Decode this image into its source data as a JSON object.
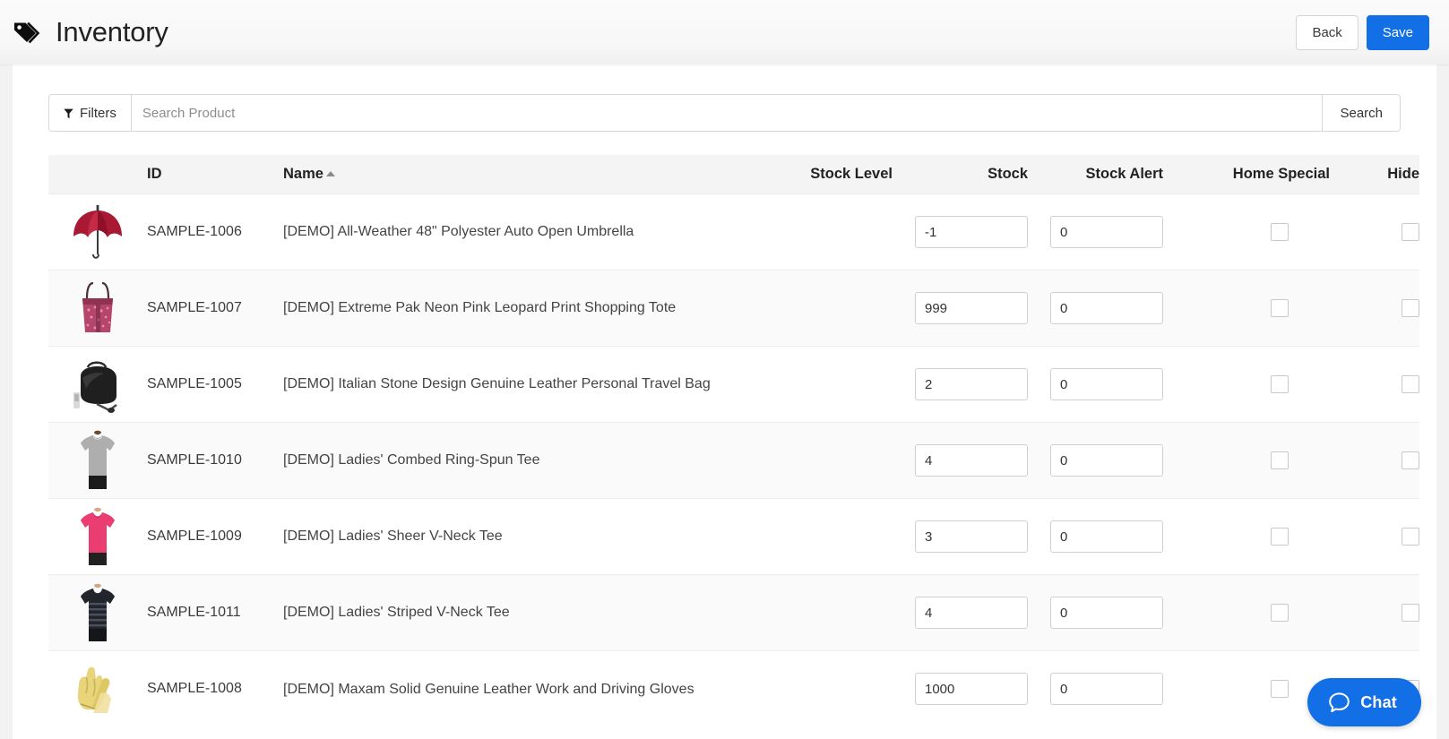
{
  "header": {
    "title": "Inventory",
    "icon": "tag-icon",
    "back_label": "Back",
    "save_label": "Save",
    "accent_color": "#126fe5"
  },
  "search": {
    "filters_label": "Filters",
    "filters_icon": "funnel-icon",
    "placeholder": "Search Product",
    "value": "",
    "search_label": "Search"
  },
  "table": {
    "columns": {
      "thumb": "",
      "id": "ID",
      "name": "Name",
      "stock_level": "Stock Level",
      "stock": "Stock",
      "stock_alert": "Stock Alert",
      "home_special": "Home Special",
      "hide": "Hide"
    },
    "sort": {
      "column": "Name",
      "direction": "asc",
      "icon": "sort-asc-caret-icon"
    },
    "rows": [
      {
        "id": "SAMPLE-1006",
        "name": "[DEMO] All-Weather 48\" Polyester Auto Open Umbrella",
        "thumb": "umbrella-thumbnail",
        "stock_level": "",
        "stock": "-1",
        "stock_alert": "0",
        "home_special": false,
        "hide": false
      },
      {
        "id": "SAMPLE-1007",
        "name": "[DEMO] Extreme Pak Neon Pink Leopard Print Shopping Tote",
        "thumb": "tote-bag-thumbnail",
        "stock_level": "",
        "stock": "999",
        "stock_alert": "0",
        "home_special": false,
        "hide": false
      },
      {
        "id": "SAMPLE-1005",
        "name": "[DEMO] Italian Stone Design Genuine Leather Personal Travel Bag",
        "thumb": "travel-bag-thumbnail",
        "stock_level": "",
        "stock": "2",
        "stock_alert": "0",
        "home_special": false,
        "hide": false
      },
      {
        "id": "SAMPLE-1010",
        "name": "[DEMO] Ladies' Combed Ring-Spun Tee",
        "thumb": "gray-tee-thumbnail",
        "stock_level": "",
        "stock": "4",
        "stock_alert": "0",
        "home_special": false,
        "hide": false
      },
      {
        "id": "SAMPLE-1009",
        "name": "[DEMO] Ladies' Sheer V-Neck Tee",
        "thumb": "pink-tee-thumbnail",
        "stock_level": "",
        "stock": "3",
        "stock_alert": "0",
        "home_special": false,
        "hide": false
      },
      {
        "id": "SAMPLE-1011",
        "name": "[DEMO] Ladies' Striped V-Neck Tee",
        "thumb": "striped-tee-thumbnail",
        "stock_level": "",
        "stock": "4",
        "stock_alert": "0",
        "home_special": false,
        "hide": false
      },
      {
        "id": "SAMPLE-1008",
        "name": "[DEMO] Maxam Solid Genuine Leather Work and Driving Gloves",
        "thumb": "gloves-thumbnail",
        "stock_level": "",
        "stock": "1000",
        "stock_alert": "0",
        "home_special": false,
        "hide": false
      }
    ]
  },
  "chat": {
    "label": "Chat",
    "icon": "chat-bubble-icon",
    "color": "#126fe5"
  }
}
